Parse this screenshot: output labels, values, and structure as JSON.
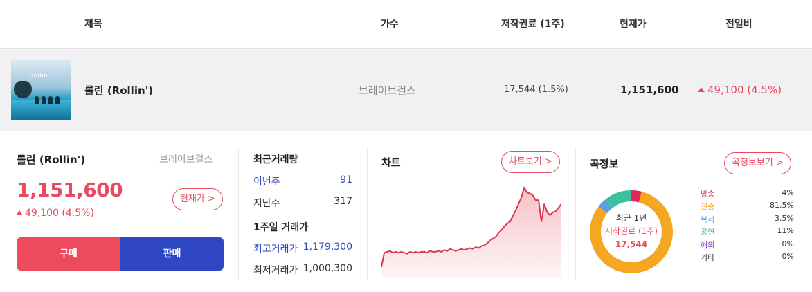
{
  "header": {
    "col_title": "제목",
    "col_artist": "가수",
    "col_royalty": "저작권료 (1주)",
    "col_price": "현재가",
    "col_change": "전일비"
  },
  "song": {
    "album_logo": "Rollin'",
    "title": "롤린 (Rollin')",
    "artist": "브레이브걸스",
    "royalty": "17,544 (1.5%)",
    "price": "1,151,600",
    "change": "49,100 (4.5%)",
    "change_direction": "up"
  },
  "detail": {
    "title": "롤린 (Rollin')",
    "artist": "브레이브걸스",
    "price": "1,151,600",
    "change": "49,100 (4.5%)",
    "current_price_button": "현재가 >",
    "buy_label": "구매",
    "sell_label": "판매"
  },
  "volume": {
    "heading": "최근거래량",
    "this_week_label": "이번주",
    "this_week_value": "91",
    "last_week_label": "지난주",
    "last_week_value": "317",
    "range_heading": "1주일 거래가",
    "high_label": "최고거래가",
    "high_value": "1,179,300",
    "low_label": "최저거래가",
    "low_value": "1,000,300"
  },
  "chart": {
    "title": "차트",
    "button": "차트보기 >"
  },
  "info": {
    "title": "곡정보",
    "button": "곡정보보기 >",
    "center_line1": "최근 1년",
    "center_line2": "저작권료 (1주)",
    "center_line3": "17,544",
    "legend": [
      {
        "label": "방송",
        "value": "4%",
        "color": "#e0245e"
      },
      {
        "label": "전송",
        "value": "81.5%",
        "color": "#f5a623"
      },
      {
        "label": "복제",
        "value": "3.5%",
        "color": "#5aa0e0"
      },
      {
        "label": "공연",
        "value": "11%",
        "color": "#3cc0a0"
      },
      {
        "label": "해외",
        "value": "0%",
        "color": "#8a3fc7"
      },
      {
        "label": "기타",
        "value": "0%",
        "color": "#333333"
      }
    ]
  },
  "chart_data": {
    "type": "area",
    "title": "",
    "xlabel": "",
    "ylabel": "",
    "series": [
      {
        "color": "#d9384a",
        "values": [
          0.12,
          0.27,
          0.28,
          0.29,
          0.27,
          0.28,
          0.27,
          0.28,
          0.27,
          0.26,
          0.28,
          0.27,
          0.28,
          0.27,
          0.28,
          0.28,
          0.27,
          0.29,
          0.28,
          0.28,
          0.29,
          0.28,
          0.3,
          0.29,
          0.31,
          0.3,
          0.29,
          0.3,
          0.31,
          0.3,
          0.31,
          0.32,
          0.31,
          0.33,
          0.32,
          0.34,
          0.35,
          0.37,
          0.4,
          0.42,
          0.44,
          0.48,
          0.51,
          0.55,
          0.58,
          0.6,
          0.66,
          0.72,
          0.79,
          0.86,
          0.96,
          0.91,
          0.9,
          0.88,
          0.83,
          0.83,
          0.6,
          0.79,
          0.7,
          0.67,
          0.7,
          0.71,
          0.75,
          0.79
        ]
      }
    ]
  }
}
